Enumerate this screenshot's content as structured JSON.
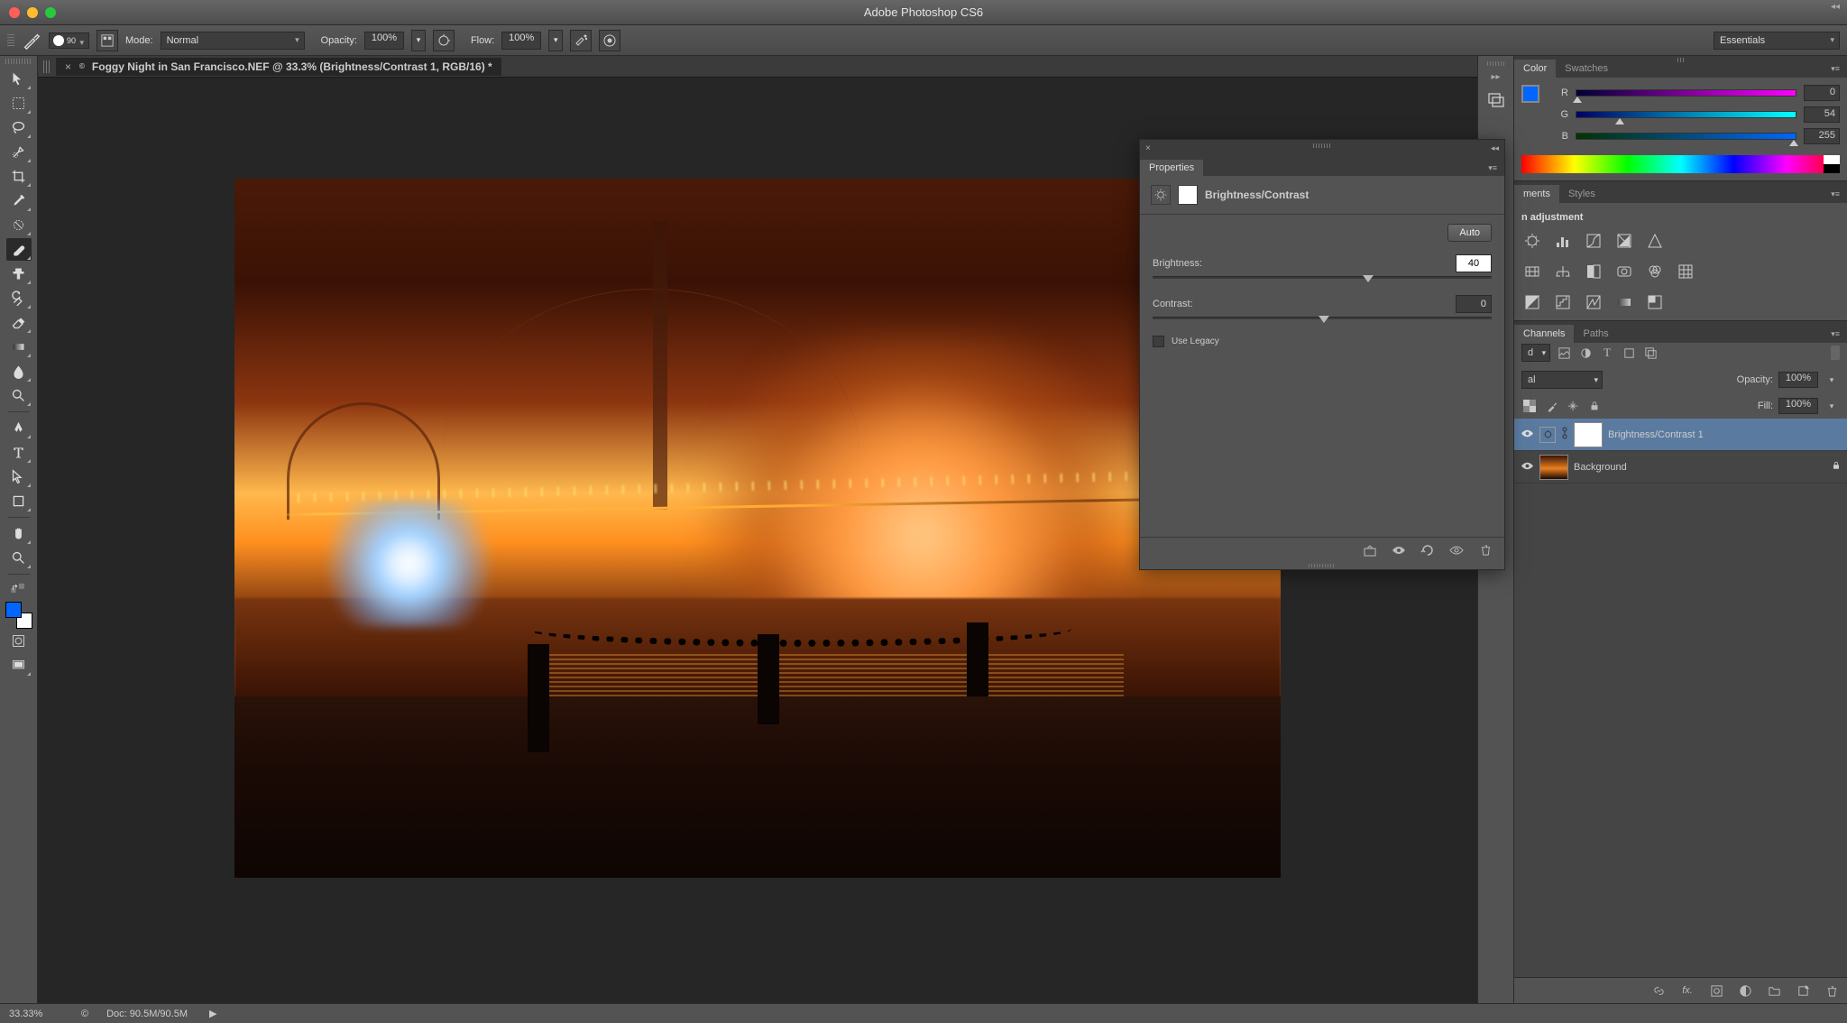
{
  "app_title": "Adobe Photoshop CS6",
  "workspace": "Essentials",
  "options_bar": {
    "brush_size": "90",
    "mode_label": "Mode:",
    "mode_value": "Normal",
    "opacity_label": "Opacity:",
    "opacity_value": "100%",
    "flow_label": "Flow:",
    "flow_value": "100%"
  },
  "document": {
    "tab_title": "Foggy Night in San Francisco.NEF @ 33.3% (Brightness/Contrast 1, RGB/16) *"
  },
  "status": {
    "zoom": "33.33%",
    "doc_info": "Doc: 90.5M/90.5M"
  },
  "color_panel": {
    "tab_color": "Color",
    "tab_swatches": "Swatches",
    "r_label": "R",
    "r_value": "0",
    "g_label": "G",
    "g_value": "54",
    "b_label": "B",
    "b_value": "255"
  },
  "adjustments_panel": {
    "tab_adjustments": "ments",
    "tab_styles": "Styles",
    "header": "n adjustment"
  },
  "channels_panel": {
    "tab_channels": "Channels",
    "tab_paths": "Paths"
  },
  "layers_panel": {
    "kind": "d",
    "blend_mode": "al",
    "opacity_label": "Opacity:",
    "opacity_value": "100%",
    "fill_label": "Fill:",
    "fill_value": "100%",
    "layers": [
      {
        "name": "Brightness/Contrast 1",
        "locked": false
      },
      {
        "name": "Background",
        "locked": true
      }
    ]
  },
  "properties_panel": {
    "title": "Properties",
    "adjustment_type": "Brightness/Contrast",
    "auto_label": "Auto",
    "brightness_label": "Brightness:",
    "brightness_value": "40",
    "contrast_label": "Contrast:",
    "contrast_value": "0",
    "legacy_label": "Use Legacy"
  }
}
